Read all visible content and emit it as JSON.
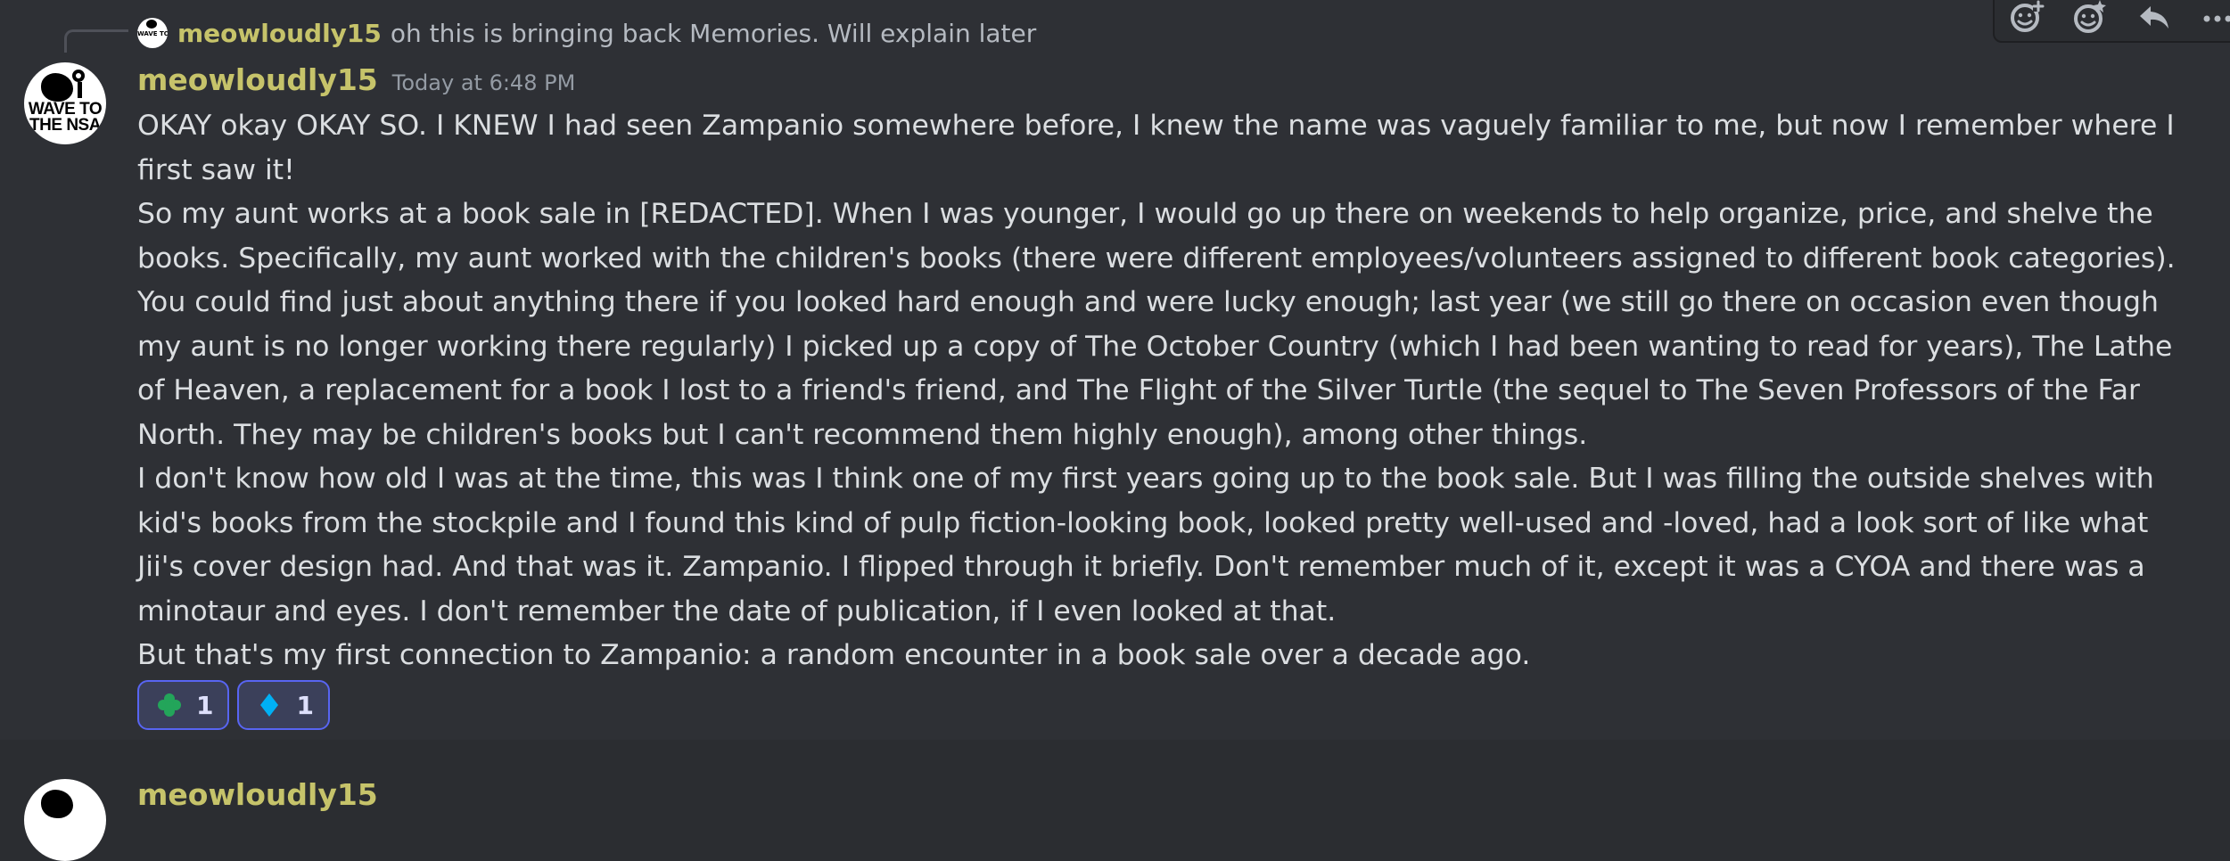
{
  "reply": {
    "author": "meowloudly15",
    "text": "oh this is bringing back Memories. Will explain later",
    "avatar_text": "WAVE TO THE NSA"
  },
  "toolbar": {
    "icons": [
      "add-reaction-icon",
      "super-reaction-icon",
      "reply-icon",
      "more-icon"
    ]
  },
  "message": {
    "avatar_text_line1": "WAVE TO",
    "avatar_text_line2": "THE NSA",
    "author": "meowloudly15",
    "timestamp": "Today at 6:48 PM",
    "paragraphs": [
      "OKAY okay OKAY SO. I KNEW I had seen Zampanio somewhere before, I knew the name was vaguely familiar to me, but now I remember where I first saw it!",
      "So my aunt works at a book sale in [REDACTED]. When I was younger, I would go up there on weekends to help organize, price, and shelve the books. Specifically, my aunt worked with the children's books (there were different employees/volunteers assigned to different book categories). You could find just about anything there if you looked hard enough and were lucky enough; last year (we still go there on occasion even though my aunt is no longer working there regularly) I picked up a copy of The October Country (which I had been wanting to read for years), The Lathe of Heaven, a replacement for a book I lost to a friend's friend, and The Flight of the Silver Turtle (the sequel to The Seven Professors of the Far North. They may be children's books but I can't recommend them highly enough), among other things.",
      "I don't know how old I was at the time, this was I think one of my first years going up to the book sale. But I was filling the outside shelves with kid's books from the stockpile and I found this kind of pulp fiction-looking book, looked pretty well-used and -loved, had a look sort of like what Jii's cover design had. And that was it. Zampanio. I flipped through it briefly. Don't remember much of it, except it was a CYOA and there was a minotaur and eyes. I don't remember the date of publication, if I even looked at that.",
      "But that's my first connection to Zampanio: a random encounter in a book sale over a decade ago."
    ],
    "reactions": [
      {
        "icon": "green-clover-icon",
        "color": "#23a55a",
        "count": "1"
      },
      {
        "icon": "blue-diamond-icon",
        "color": "#00b0f4",
        "count": "1"
      }
    ]
  },
  "next_message": {
    "author": "meowloudly15"
  },
  "colors": {
    "background": "#2b2d31",
    "hover_background": "#2e3035",
    "author": "#c6c36a",
    "text": "#dbdee1",
    "muted": "#949ba4",
    "reaction_border": "#5865f2"
  }
}
